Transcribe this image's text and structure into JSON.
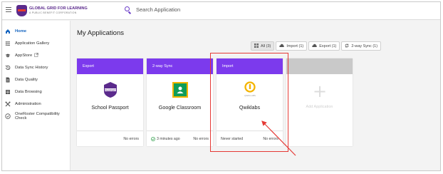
{
  "topbar": {
    "logo_title": "GLOBAL GRID FOR LEARNING",
    "logo_sub": "A PUBLIC BENEFIT CORPORATION",
    "search_placeholder": "Search Application"
  },
  "sidebar": {
    "items": [
      {
        "label": "Home",
        "icon": "home-icon"
      },
      {
        "label": "Application Gallery",
        "icon": "list-icon"
      },
      {
        "label": "AppStore",
        "icon": "hat-icon"
      },
      {
        "label": "Data Sync History",
        "icon": "history-icon"
      },
      {
        "label": "Data Quality",
        "icon": "file-icon"
      },
      {
        "label": "Data Browsing",
        "icon": "table-icon"
      },
      {
        "label": "Administration",
        "icon": "tools-icon"
      },
      {
        "label": "OneRoster Compatibility Check",
        "icon": "check-icon"
      }
    ]
  },
  "main": {
    "title": "My Applications",
    "filters": [
      {
        "label": "All (3)"
      },
      {
        "label": "Import (1)"
      },
      {
        "label": "Export (1)"
      },
      {
        "label": "2-way Sync (1)"
      }
    ],
    "cards": [
      {
        "type": "Export",
        "name": "School Passport",
        "status_left": "",
        "status_right": "No errors"
      },
      {
        "type": "2-way Sync",
        "name": "Google Classroom",
        "status_left": "3 minutes ago",
        "status_right": "No errors"
      },
      {
        "type": "Import",
        "name": "Qwiklabs",
        "status_left": "Never started",
        "status_right": "No errors"
      }
    ],
    "add_label": "Add Application",
    "passport_badge_text": "PASSPORT",
    "qwiklabs_logo_text": "QWIKLABS"
  },
  "colors": {
    "accent": "#7c3aed",
    "highlight": "#e53935",
    "active_nav": "#1565c0"
  }
}
